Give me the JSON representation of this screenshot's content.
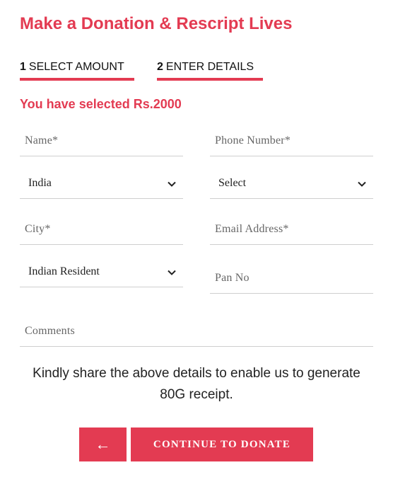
{
  "title": "Make a Donation & Rescript Lives",
  "steps": [
    {
      "num": "1",
      "label": "SELECT AMOUNT"
    },
    {
      "num": "2",
      "label": "ENTER DETAILS"
    }
  ],
  "selected_text": "You have selected Rs.2000",
  "form": {
    "name_placeholder": "Name*",
    "phone_placeholder": "Phone Number*",
    "country_value": "India",
    "state_value": "Select",
    "city_placeholder": "City*",
    "email_placeholder": "Email Address*",
    "residency_value": "Indian Resident",
    "pan_placeholder": "Pan No",
    "comments_placeholder": "Comments"
  },
  "note": "Kindly share the above details to enable us to generate 80G receipt.",
  "buttons": {
    "back_icon": "←",
    "continue_label": "CONTINUE TO DONATE"
  },
  "colors": {
    "accent": "#e33b52"
  }
}
